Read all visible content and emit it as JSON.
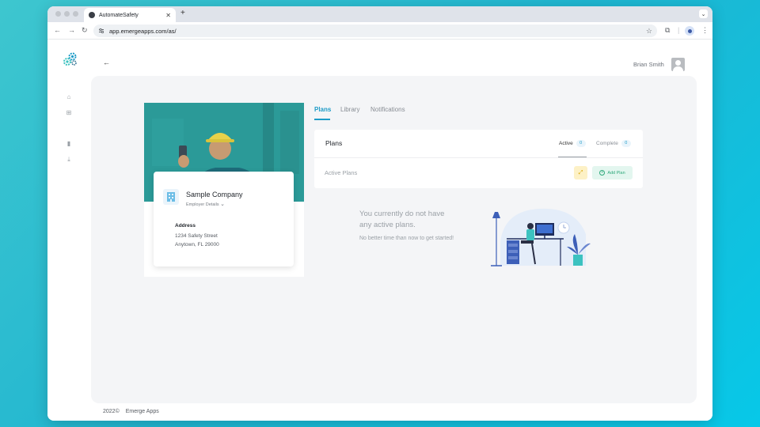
{
  "browser": {
    "tab_title": "AutomateSafety",
    "url": "app.emergeapps.com/as/"
  },
  "header": {
    "user_name": "Brian Smith"
  },
  "company": {
    "name": "Sample Company",
    "details_label": "Employer Details",
    "address_label": "Address",
    "address_line1": "1234 Safety Street",
    "address_line2": "Anytown, FL 29000"
  },
  "tabs": [
    {
      "label": "Plans",
      "active": true
    },
    {
      "label": "Library",
      "active": false
    },
    {
      "label": "Notifications",
      "active": false
    }
  ],
  "plans_card": {
    "title": "Plans",
    "status_tabs": [
      {
        "label": "Active",
        "count": "0"
      },
      {
        "label": "Complete",
        "count": "0"
      }
    ],
    "active_plans_label": "Active Plans",
    "add_plan_label": "Add Plan"
  },
  "empty_state": {
    "line1": "You currently do not have",
    "line2": "any active plans.",
    "subtitle": "No better time than now to get started!"
  },
  "footer": {
    "year": "2022©",
    "brand": "Emerge Apps"
  },
  "colors": {
    "accent": "#1d9bc7",
    "hero_teal": "#2aa5a3",
    "add_plan_green": "#2ea87b",
    "expand_yellow": "#fdf1c6"
  }
}
